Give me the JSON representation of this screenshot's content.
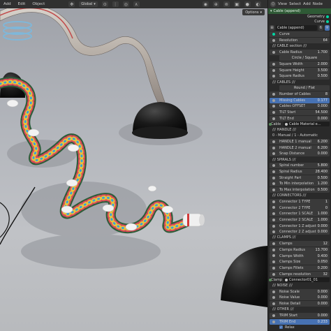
{
  "viewport_header": {
    "menus": [
      "Add",
      "Edit",
      "Object"
    ],
    "transform_orientation": "Global",
    "options_label": "Options"
  },
  "panel_header": {
    "menus": [
      "View",
      "Select",
      "Add",
      "Node"
    ]
  },
  "node": {
    "title": "Cable (append)",
    "outputs": [
      "Geometry",
      "Curve"
    ],
    "group_name": "Cable (append)",
    "group_users": "6"
  },
  "rows": [
    {
      "kind": "field",
      "label": "Curve",
      "value": "",
      "socket": "c"
    },
    {
      "kind": "field",
      "label": "Resolution",
      "value": "64",
      "socket": "g"
    },
    {
      "kind": "section",
      "label": "/// CABLE section ///"
    },
    {
      "kind": "field",
      "label": "Cable Radius",
      "value": "1.700",
      "socket": "g"
    },
    {
      "kind": "button",
      "label": "Circle / Square"
    },
    {
      "kind": "field",
      "label": "Square Width",
      "value": "2.000",
      "socket": "g"
    },
    {
      "kind": "field",
      "label": "Square Height",
      "value": "3.500",
      "socket": "g"
    },
    {
      "kind": "field",
      "label": "Square Radius",
      "value": "0.500",
      "socket": "g"
    },
    {
      "kind": "section",
      "label": "/// CABLES ///"
    },
    {
      "kind": "button",
      "label": "Round / Flat"
    },
    {
      "kind": "field",
      "label": "Number of Cables",
      "value": "8",
      "socket": "g"
    },
    {
      "kind": "field",
      "label": "Missing Cables",
      "value": "0.177",
      "socket": "g",
      "highlight": true
    },
    {
      "kind": "field",
      "label": "Cables OFFSET",
      "value": "0.000",
      "socket": "g"
    },
    {
      "kind": "field",
      "label": "TILT Start",
      "value": "54.500",
      "socket": "g"
    },
    {
      "kind": "field",
      "label": "TILT End",
      "value": "0.000",
      "socket": "g"
    },
    {
      "kind": "material",
      "label": "Cable ...",
      "value": "Cable Material e...",
      "socket": "b"
    },
    {
      "kind": "section",
      "label": "/// HANDLE ///"
    },
    {
      "kind": "section",
      "label": "0 - Manual / 1 - Automatic"
    },
    {
      "kind": "field",
      "label": "HANDLE 1 manual",
      "value": "6.200",
      "socket": "g"
    },
    {
      "kind": "field",
      "label": "HANDLE 2 manual",
      "value": "6.200",
      "socket": "g"
    },
    {
      "kind": "field",
      "label": "Snap Distance",
      "value": "0.000",
      "socket": "g"
    },
    {
      "kind": "section",
      "label": "/// SPIRALS ///"
    },
    {
      "kind": "field",
      "label": "Spiral number",
      "value": "5.800",
      "socket": "g"
    },
    {
      "kind": "field",
      "label": "Spiral Radius",
      "value": "28.400",
      "socket": "g"
    },
    {
      "kind": "field",
      "label": "Straight Part",
      "value": "0.500",
      "socket": "g"
    },
    {
      "kind": "field",
      "label": "To Min interpolation",
      "value": "1.200",
      "socket": "g"
    },
    {
      "kind": "field",
      "label": "To Max interpolation",
      "value": "0.500",
      "socket": "g"
    },
    {
      "kind": "section",
      "label": "/// CONNECTORS ///"
    },
    {
      "kind": "field",
      "label": "Connector 1 TYPE",
      "value": "1",
      "socket": "g"
    },
    {
      "kind": "field",
      "label": "Connector 2 TYPE",
      "value": "0",
      "socket": "g"
    },
    {
      "kind": "field",
      "label": "Connector 1 SCALE",
      "value": "1.000",
      "socket": "g"
    },
    {
      "kind": "field",
      "label": "Connector 2 SCALE",
      "value": "1.000",
      "socket": "g"
    },
    {
      "kind": "field",
      "label": "Connector 1 Z adjust",
      "value": "0.000",
      "socket": "g"
    },
    {
      "kind": "field",
      "label": "Connector 2 Z adjust",
      "value": "0.000",
      "socket": "g"
    },
    {
      "kind": "section",
      "label": "/// CLAMPS ///"
    },
    {
      "kind": "field",
      "label": "Clamps",
      "value": "12",
      "socket": "g"
    },
    {
      "kind": "field",
      "label": "Clamps Radius",
      "value": "13.700",
      "socket": "g"
    },
    {
      "kind": "field",
      "label": "Clamps Width",
      "value": "0.400",
      "socket": "g"
    },
    {
      "kind": "field",
      "label": "Clamps Size",
      "value": "0.050",
      "socket": "g"
    },
    {
      "kind": "field",
      "label": "Clamps Fillets",
      "value": "0.200",
      "socket": "g"
    },
    {
      "kind": "field",
      "label": "Clamps resolution",
      "value": "32",
      "socket": "g"
    },
    {
      "kind": "material",
      "label": "Clamp...",
      "value": "Connector01_01",
      "socket": "b"
    },
    {
      "kind": "section",
      "label": "/// NOISE ///"
    },
    {
      "kind": "field",
      "label": "Noise Scale",
      "value": "0.000",
      "socket": "g"
    },
    {
      "kind": "field",
      "label": "Noise Value",
      "value": "0.000",
      "socket": "g"
    },
    {
      "kind": "field",
      "label": "Noise Detail",
      "value": "0.000",
      "socket": "g"
    },
    {
      "kind": "section",
      "label": "/// OTHER ///"
    },
    {
      "kind": "field",
      "label": "TRIM Start",
      "value": "0.000",
      "socket": "g"
    },
    {
      "kind": "field",
      "label": "TRIM End",
      "value": "0.233",
      "socket": "g",
      "highlight": true
    },
    {
      "kind": "toggle",
      "label": "Relax",
      "value": "✓"
    }
  ],
  "colors": {
    "accent": "#4772b3",
    "node_header": "#2f5a36",
    "geometry_socket": "#00d6a3"
  }
}
